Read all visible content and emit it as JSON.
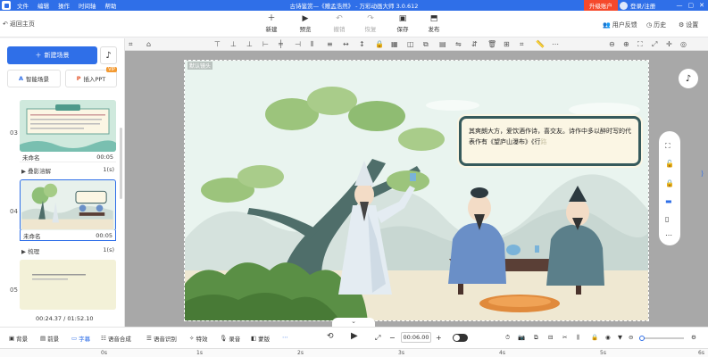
{
  "titlebar": {
    "menu": [
      "文件",
      "编辑",
      "操作",
      "时间轴",
      "帮助"
    ],
    "title": "古诗鉴赏—《赠孟浩然》 - 万彩动画大师 3.0.612",
    "upgrade": "升级账户",
    "login": "登录/注册"
  },
  "toolbar": {
    "back": "返回主页",
    "new": "新建",
    "preview": "预览",
    "undo": "撤销",
    "redo": "恢复",
    "save": "保存",
    "publish": "发布",
    "feedback": "用户反馈",
    "history": "历史",
    "settings": "设置"
  },
  "left": {
    "new_scene": "新建场景",
    "smart_scene": "智能场景",
    "import_ppt": "插入PPT",
    "vip": "VIP",
    "scenes": [
      {
        "num": "03",
        "name": "未命名",
        "time": "00:05"
      },
      {
        "num": "04",
        "name": "未命名",
        "time": "00:05"
      },
      {
        "num": "05"
      }
    ],
    "transitions": [
      {
        "label": "叠影溶解",
        "dur": "1(s)"
      },
      {
        "label": "梳理",
        "dur": "1(s)"
      }
    ],
    "time_current": "00:24.37",
    "time_total": "/ 01:52.10"
  },
  "stage": {
    "camera_label": "默认镜头",
    "speech_text": "其爽朗大方，爱饮酒作诗，喜交友。诗作中多以醉时写的代表作有《望庐山瀑布》《行",
    "speech_fade": "路"
  },
  "bottom": {
    "background": "背景",
    "foreground": "前景",
    "subtitle": "字幕",
    "tts": "语音合成",
    "asr": "语音识别",
    "effects": "特效",
    "record": "录音",
    "layout": "蒙版",
    "time_value": "00:06.00"
  },
  "ruler": [
    "0s",
    "1s",
    "2s",
    "3s",
    "4s",
    "5s",
    "6s"
  ],
  "colors": {
    "accent": "#2f6fe8",
    "upgrade": "#f5492b"
  }
}
